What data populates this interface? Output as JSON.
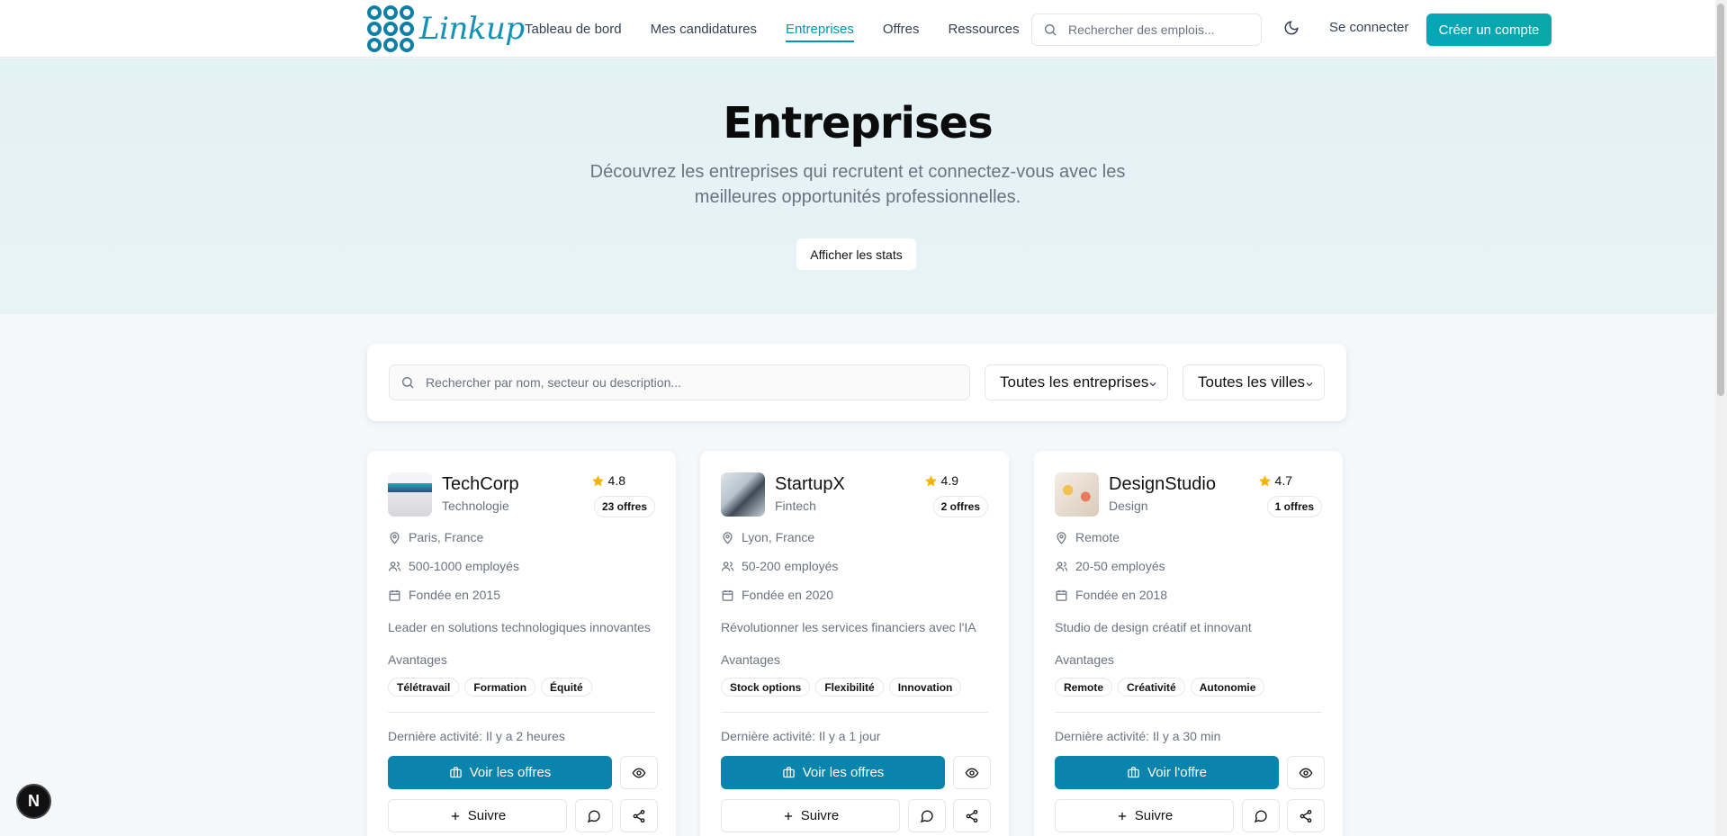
{
  "header": {
    "logo_text": "Linkup",
    "nav": [
      "Tableau de bord",
      "Mes candidatures",
      "Entreprises",
      "Offres",
      "Ressources"
    ],
    "active_nav": "Entreprises",
    "search_placeholder": "Rechercher des emplois...",
    "login_label": "Se connecter",
    "signup_label": "Créer un compte",
    "accent_color": "#0891b2"
  },
  "hero": {
    "title": "Entreprises",
    "subtitle": "Découvrez les entreprises qui recrutent et connectez-vous avec les meilleures opportunités professionnelles.",
    "stats_button": "Afficher les stats"
  },
  "filters": {
    "search_placeholder": "Rechercher par nom, secteur ou description...",
    "company_filter": "Toutes les entreprises",
    "city_filter": "Toutes les villes"
  },
  "companies": [
    {
      "name": "TechCorp",
      "sector": "Technologie",
      "rating": "4.8",
      "offers": "23 offres",
      "location": "Paris, France",
      "employees": "500-1000 employés",
      "founded": "Fondée en 2015",
      "description": "Leader en solutions technologiques innovantes",
      "advantages_label": "Avantages",
      "advantages": [
        "Télétravail",
        "Formation",
        "Équité"
      ],
      "activity": "Dernière activité: Il y a 2 heures",
      "primary_label": "Voir les offres",
      "follow_label": "Suivre"
    },
    {
      "name": "StartupX",
      "sector": "Fintech",
      "rating": "4.9",
      "offers": "2 offres",
      "location": "Lyon, France",
      "employees": "50-200 employés",
      "founded": "Fondée en 2020",
      "description": "Révolutionner les services financiers avec l'IA",
      "advantages_label": "Avantages",
      "advantages": [
        "Stock options",
        "Flexibilité",
        "Innovation"
      ],
      "activity": "Dernière activité: Il y a 1 jour",
      "primary_label": "Voir les offres",
      "follow_label": "Suivre"
    },
    {
      "name": "DesignStudio",
      "sector": "Design",
      "rating": "4.7",
      "offers": "1 offres",
      "location": "Remote",
      "employees": "20-50 employés",
      "founded": "Fondée en 2018",
      "description": "Studio de design créatif et innovant",
      "advantages_label": "Avantages",
      "advantages": [
        "Remote",
        "Créativité",
        "Autonomie"
      ],
      "activity": "Dernière activité: Il y a 30 min",
      "primary_label": "Voir l'offre",
      "follow_label": "Suivre"
    }
  ],
  "dev_badge": "N"
}
